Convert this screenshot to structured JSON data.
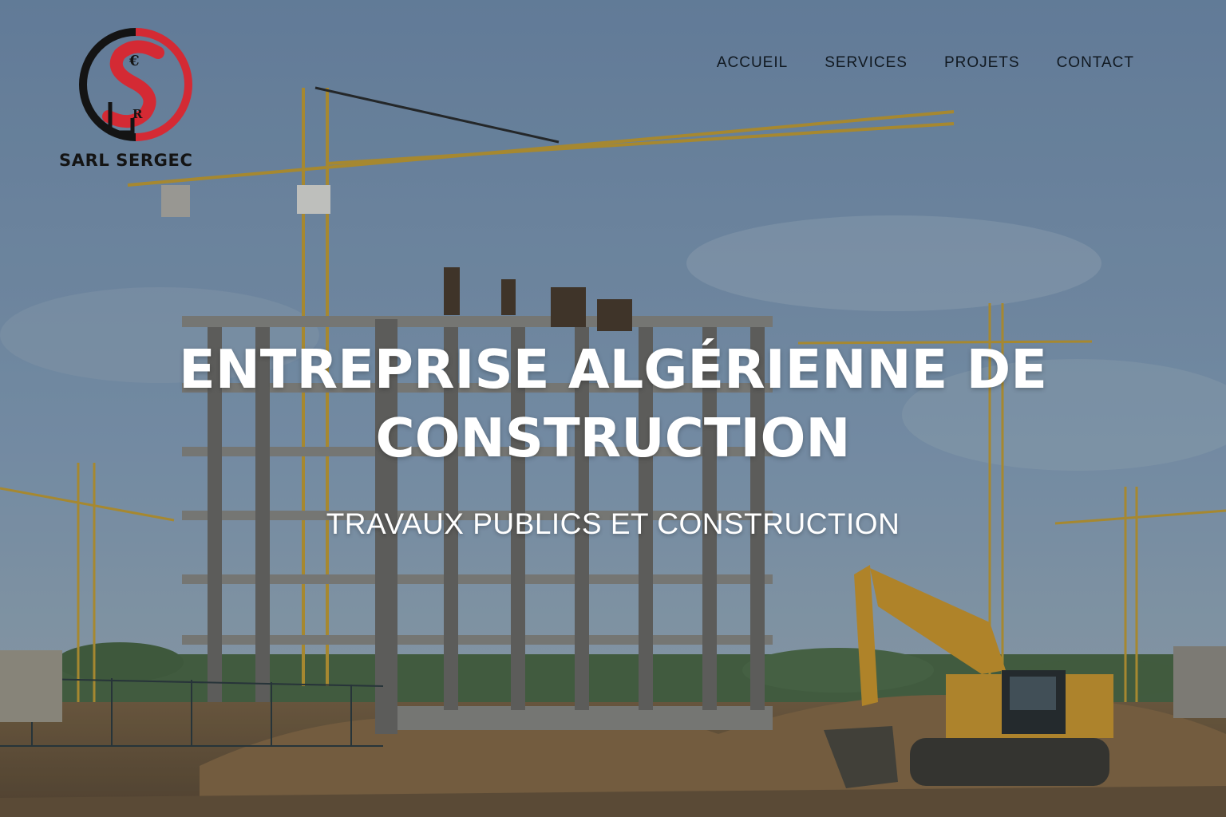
{
  "brand": {
    "name": "SARL SERGEC",
    "logo_letters": [
      "S",
      "E",
      "R",
      "G"
    ],
    "colors": {
      "red": "#d42a34",
      "black": "#141414"
    }
  },
  "nav": {
    "items": [
      {
        "label": "ACCUEIL"
      },
      {
        "label": "SERVICES"
      },
      {
        "label": "PROJETS"
      },
      {
        "label": "CONTACT"
      }
    ]
  },
  "hero": {
    "title": "ENTREPRISE ALGÉRIENNE DE CONSTRUCTION",
    "subtitle": "TRAVAUX PUBLICS ET CONSTRUCTION",
    "background": "construction-site-photo",
    "colors": {
      "sky": "#7f9ab6",
      "crane": "#c8a032",
      "concrete": "#8d8a84",
      "earth": "#8d6d48",
      "excavator": "#d49a2a"
    }
  }
}
